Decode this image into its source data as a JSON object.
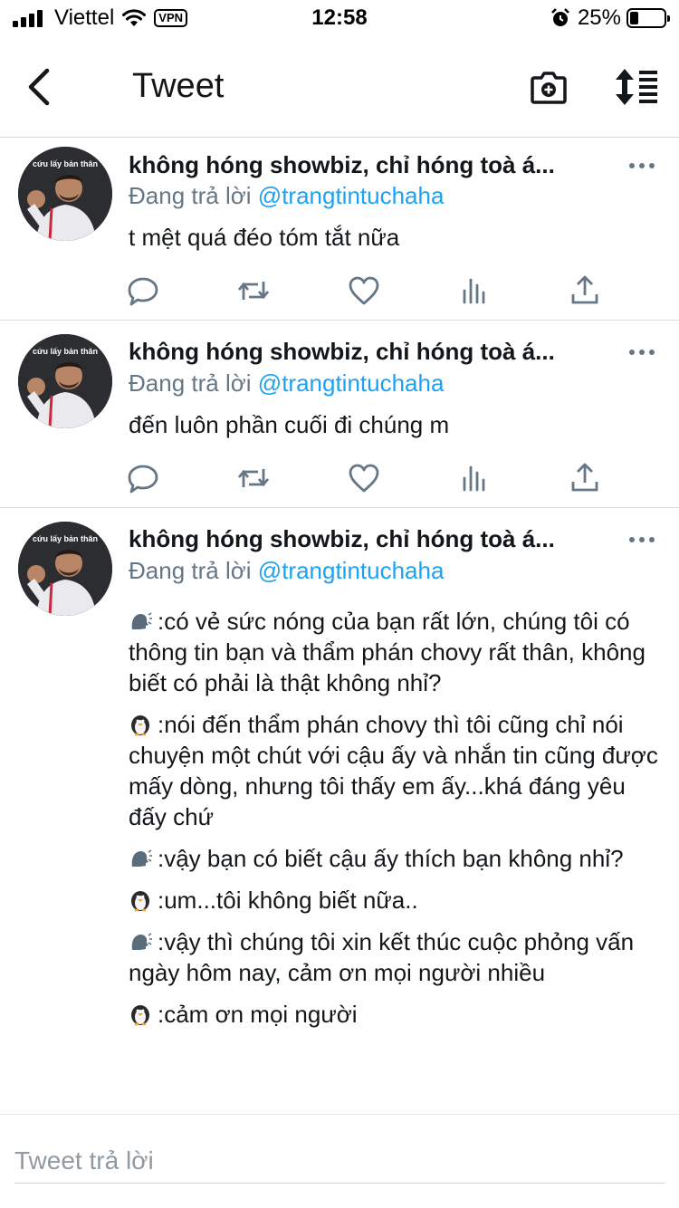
{
  "status_bar": {
    "carrier": "Viettel",
    "vpn": "VPN",
    "time": "12:58",
    "battery_percent": "25%",
    "battery_level": 0.25
  },
  "nav": {
    "title": "Tweet",
    "back_icon": "chevron-left-icon",
    "camera_icon": "camera-add-icon",
    "sort_icon": "sort-icon"
  },
  "tweets": [
    {
      "name": "không hóng showbiz, chỉ hóng toà á...",
      "reply_prefix": "Đang trả lời",
      "handle": "@trangtintuchaha",
      "text": "t mệt quá đéo tóm tắt nữa",
      "avatar_caption": "cứu lấy bản thân"
    },
    {
      "name": "không hóng showbiz, chỉ hóng toà á...",
      "reply_prefix": "Đang trả lời",
      "handle": "@trangtintuchaha",
      "text": "đến luôn phần cuối đi chúng m",
      "avatar_caption": "cứu lấy bản thân"
    },
    {
      "name": "không hóng showbiz, chỉ hóng toà á...",
      "reply_prefix": "Đang trả lời",
      "handle": "@trangtintuchaha",
      "avatar_caption": "cứu lấy bản thân",
      "lines": [
        {
          "speaker": "speaking-head-emoji",
          "text": ":có vẻ sức nóng của bạn rất lớn, chúng tôi có thông tin bạn và thẩm phán chovy rất thân, không biết có phải là thật không nhỉ?"
        },
        {
          "speaker": "penguin-emoji",
          "text": ":nói đến thẩm phán chovy thì tôi cũng chỉ nói chuyện một chút với cậu ấy và nhắn tin cũng được mấy dòng, nhưng tôi thấy em ấy...khá đáng yêu đấy chứ"
        },
        {
          "speaker": "speaking-head-emoji",
          "text": ":vậy bạn có biết cậu ấy thích bạn không nhỉ?"
        },
        {
          "speaker": "penguin-emoji",
          "text": ":um...tôi không biết nữa.."
        },
        {
          "speaker": "speaking-head-emoji",
          "text": ":vậy thì chúng tôi xin kết thúc cuộc phỏng vấn ngày hôm nay, cảm ơn mọi người nhiều"
        },
        {
          "speaker": "penguin-emoji",
          "text": ":cảm ơn mọi người"
        }
      ]
    }
  ],
  "actions": [
    "reply-icon",
    "retweet-icon",
    "like-icon",
    "analytics-icon",
    "share-icon"
  ],
  "composer": {
    "placeholder": "Tweet trả lời"
  },
  "colors": {
    "link": "#1da1f2",
    "secondary_text": "#657786",
    "icon": "#657786"
  }
}
